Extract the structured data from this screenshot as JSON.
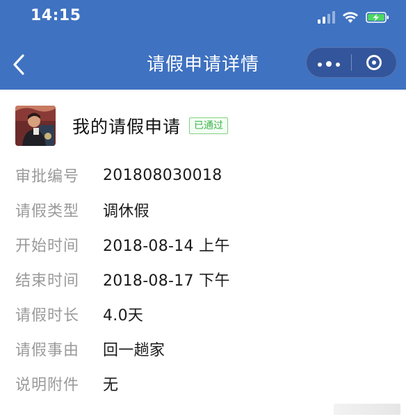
{
  "status_bar": {
    "time": "14:15",
    "icons": [
      "signal-icon",
      "wifi-icon",
      "battery-charging-icon"
    ]
  },
  "nav": {
    "title": "请假申请详情",
    "back_icon": "chevron-left-icon",
    "more_icon": "more-dots-icon",
    "close_icon": "target-close-icon"
  },
  "colors": {
    "header_bg": "#3f72c1",
    "badge_green": "#3cb34a",
    "label_gray": "#9a9a9a",
    "battery_green": "#4cd964"
  },
  "application": {
    "title": "我的请假申请",
    "status": "已通过",
    "details": [
      {
        "label": "审批编号",
        "value": "201808030018"
      },
      {
        "label": "请假类型",
        "value": "调休假"
      },
      {
        "label": "开始时间",
        "value": "2018-08-14 上午"
      },
      {
        "label": "结束时间",
        "value": "2018-08-17 下午"
      },
      {
        "label": "请假时长",
        "value": "4.0天"
      },
      {
        "label": "请假事由",
        "value": "回一趟家"
      },
      {
        "label": "说明附件",
        "value": "无"
      }
    ]
  }
}
